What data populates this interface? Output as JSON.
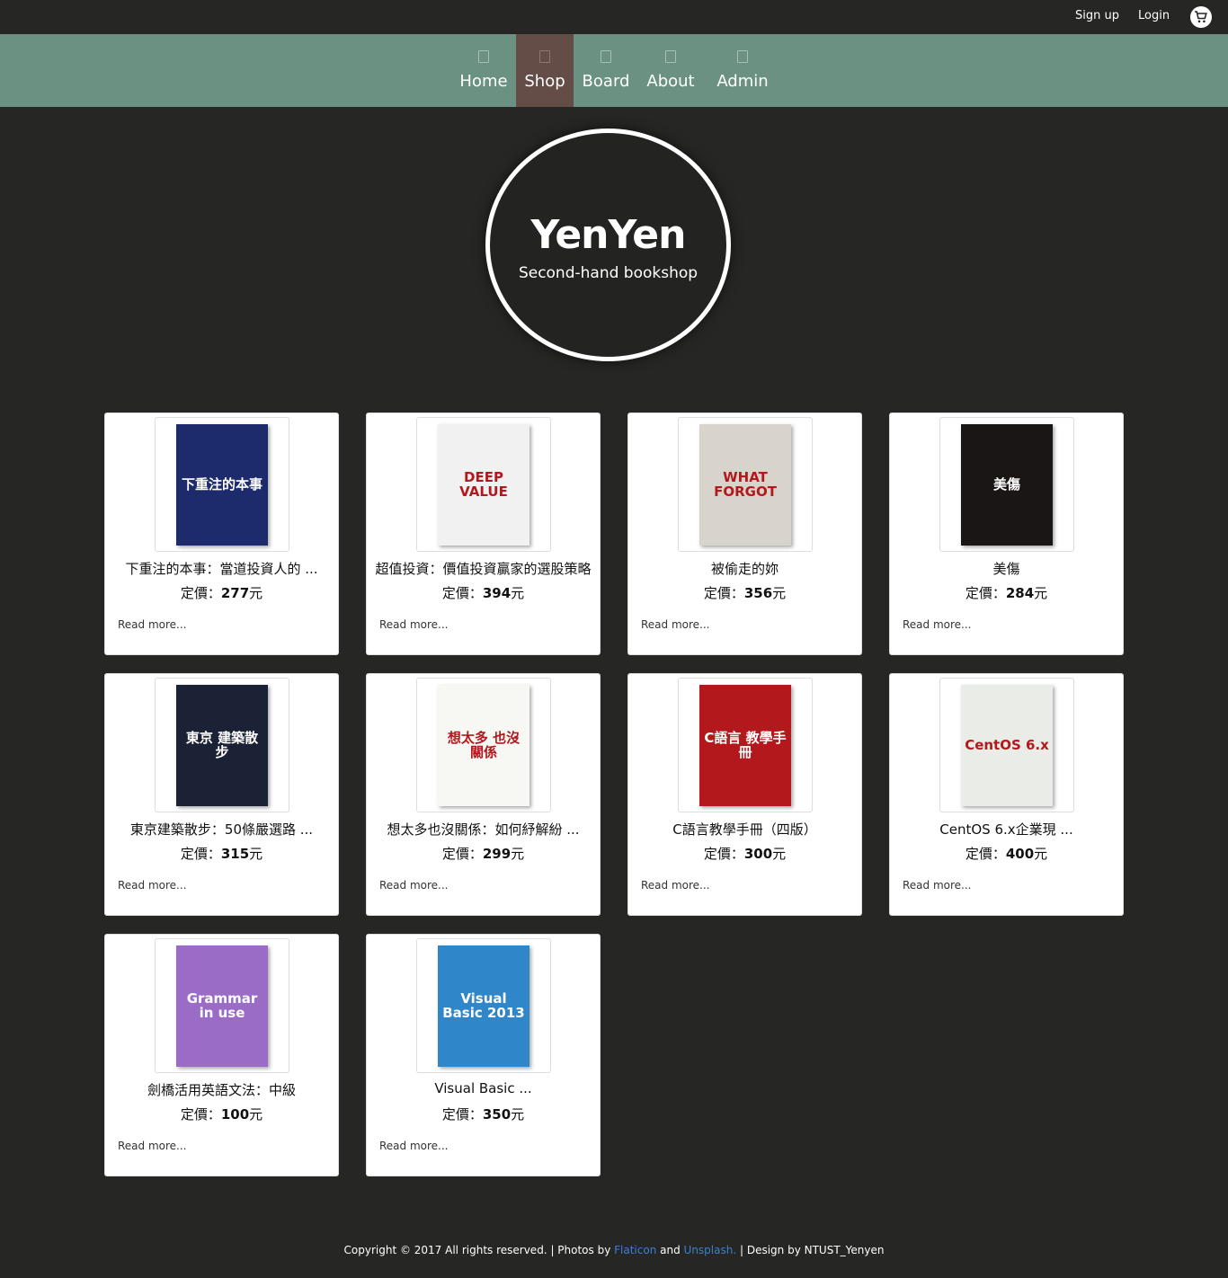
{
  "header": {
    "signup": "Sign up",
    "login": "Login",
    "cart_icon": "cart-icon"
  },
  "nav": [
    {
      "label": "Home",
      "icon": "home-icon"
    },
    {
      "label": "Shop",
      "icon": "shop-icon",
      "active": true
    },
    {
      "label": "Board",
      "icon": "board-icon"
    },
    {
      "label": "About",
      "icon": "about-icon"
    },
    {
      "label": "Admin",
      "icon": "admin-icon"
    }
  ],
  "brand": {
    "title": "YenYen",
    "subtitle": "Second-hand bookshop"
  },
  "products": [
    {
      "title": "下重注的本事：當道投資人的 ...",
      "price_label": "定價：",
      "price": "277",
      "currency": "元",
      "read_more": "Read more...",
      "cover_text": "下重注的本事",
      "cover_color": "#1d2a6b"
    },
    {
      "title": "超值投資：價值投資贏家的選股策略",
      "price_label": "定價：",
      "price": "394",
      "currency": "元",
      "read_more": "Read more...",
      "cover_text": "DEEP VALUE",
      "cover_color": "#f1f1f1"
    },
    {
      "title": "被偷走的妳",
      "price_label": "定價：",
      "price": "356",
      "currency": "元",
      "read_more": "Read more...",
      "cover_text": "WHAT FORGOT",
      "cover_color": "#d9d4cb"
    },
    {
      "title": "美傷",
      "price_label": "定價：",
      "price": "284",
      "currency": "元",
      "read_more": "Read more...",
      "cover_text": "美傷",
      "cover_color": "#1a1616"
    },
    {
      "title": "東京建築散步：50條嚴選路 ...",
      "price_label": "定價：",
      "price": "315",
      "currency": "元",
      "read_more": "Read more...",
      "cover_text": "東京 建築散步",
      "cover_color": "#1c2235"
    },
    {
      "title": "想太多也沒關係：如何紓解紛 ...",
      "price_label": "定價：",
      "price": "299",
      "currency": "元",
      "read_more": "Read more...",
      "cover_text": "想太多 也沒關係",
      "cover_color": "#f7f7f3"
    },
    {
      "title": "C語言教學手冊（四版）",
      "price_label": "定價：",
      "price": "300",
      "currency": "元",
      "read_more": "Read more...",
      "cover_text": "C語言 教學手冊",
      "cover_color": "#b3191c"
    },
    {
      "title": "CentOS 6.x企業現 ...",
      "price_label": "定價：",
      "price": "400",
      "currency": "元",
      "read_more": "Read more...",
      "cover_text": "CentOS 6.x",
      "cover_color": "#e9ece7"
    },
    {
      "title": "劍橋活用英語文法：中級",
      "price_label": "定價：",
      "price": "100",
      "currency": "元",
      "read_more": "Read more...",
      "cover_text": "Grammar in use",
      "cover_color": "#9b6cc6"
    },
    {
      "title": "Visual Basic ...",
      "price_label": "定價：",
      "price": "350",
      "currency": "元",
      "read_more": "Read more...",
      "cover_text": "Visual Basic 2013",
      "cover_color": "#2f86c9"
    }
  ],
  "footer": {
    "prefix": "Copyright © 2017 All rights reserved. | Photos by ",
    "link1": "Flaticon",
    "mid": " and ",
    "link2": "Unsplash.",
    "suffix": " | Design by NTUST_Yenyen"
  }
}
